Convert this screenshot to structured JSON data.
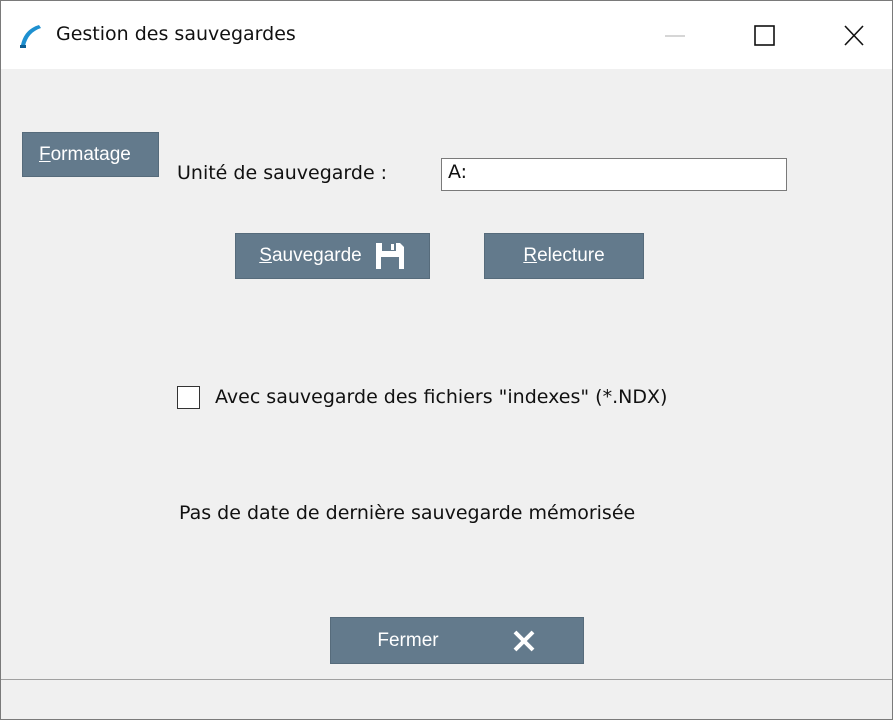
{
  "window": {
    "title": "Gestion des sauvegardes"
  },
  "buttons": {
    "format": {
      "accel": "F",
      "rest": "ormatage"
    },
    "save": {
      "accel": "S",
      "rest": "auvegarde",
      "icon": "floppy-disk-icon"
    },
    "reload": {
      "accel": "R",
      "rest": "electure"
    },
    "close": {
      "label": "Fermer",
      "icon": "close-x-icon"
    }
  },
  "backup_unit": {
    "label": "Unité de sauvegarde :",
    "value": "A:"
  },
  "option": {
    "label": "Avec sauvegarde des fichiers \"indexes\" (*.NDX)",
    "checked": false
  },
  "status": {
    "text": "Pas de date de dernière sauvegarde mémorisée"
  },
  "colors": {
    "button_bg": "#637a8c",
    "icon_blue": "#1e90d0"
  }
}
